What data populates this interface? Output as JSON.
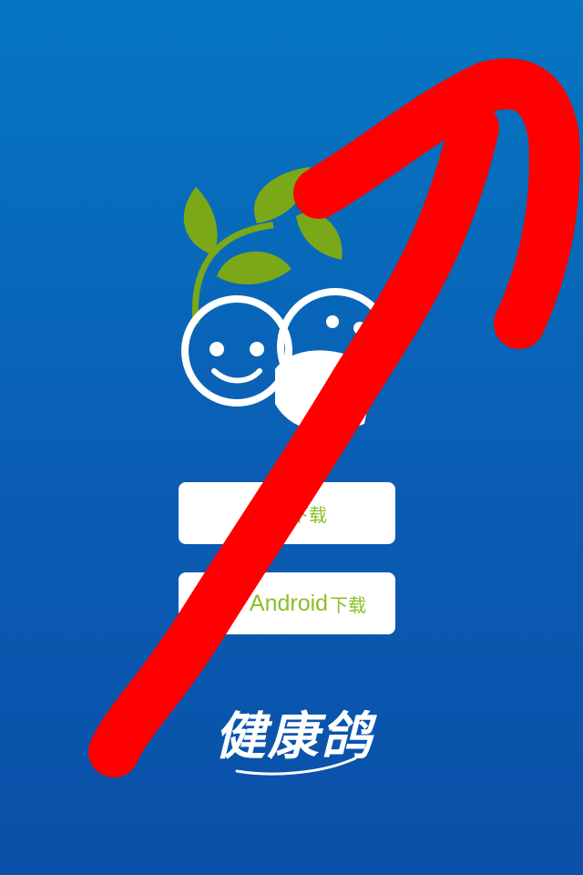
{
  "buttons": {
    "ios": {
      "platform_label": "",
      "suffix_label": "下载",
      "icon": "apple-icon"
    },
    "android": {
      "platform_label": "Android",
      "suffix_label": "下载",
      "icon": "android-icon"
    }
  },
  "brand": {
    "name": "健康鸽"
  },
  "colors": {
    "background": "#0a5db3",
    "leaf_green": "#7aa818",
    "button_text": "#8bbf2a",
    "annotation_red": "#ff0000"
  },
  "icons": [
    "leaves-icon",
    "smiley-face-icon",
    "masked-smiley-face-icon",
    "apple-icon",
    "android-icon"
  ]
}
